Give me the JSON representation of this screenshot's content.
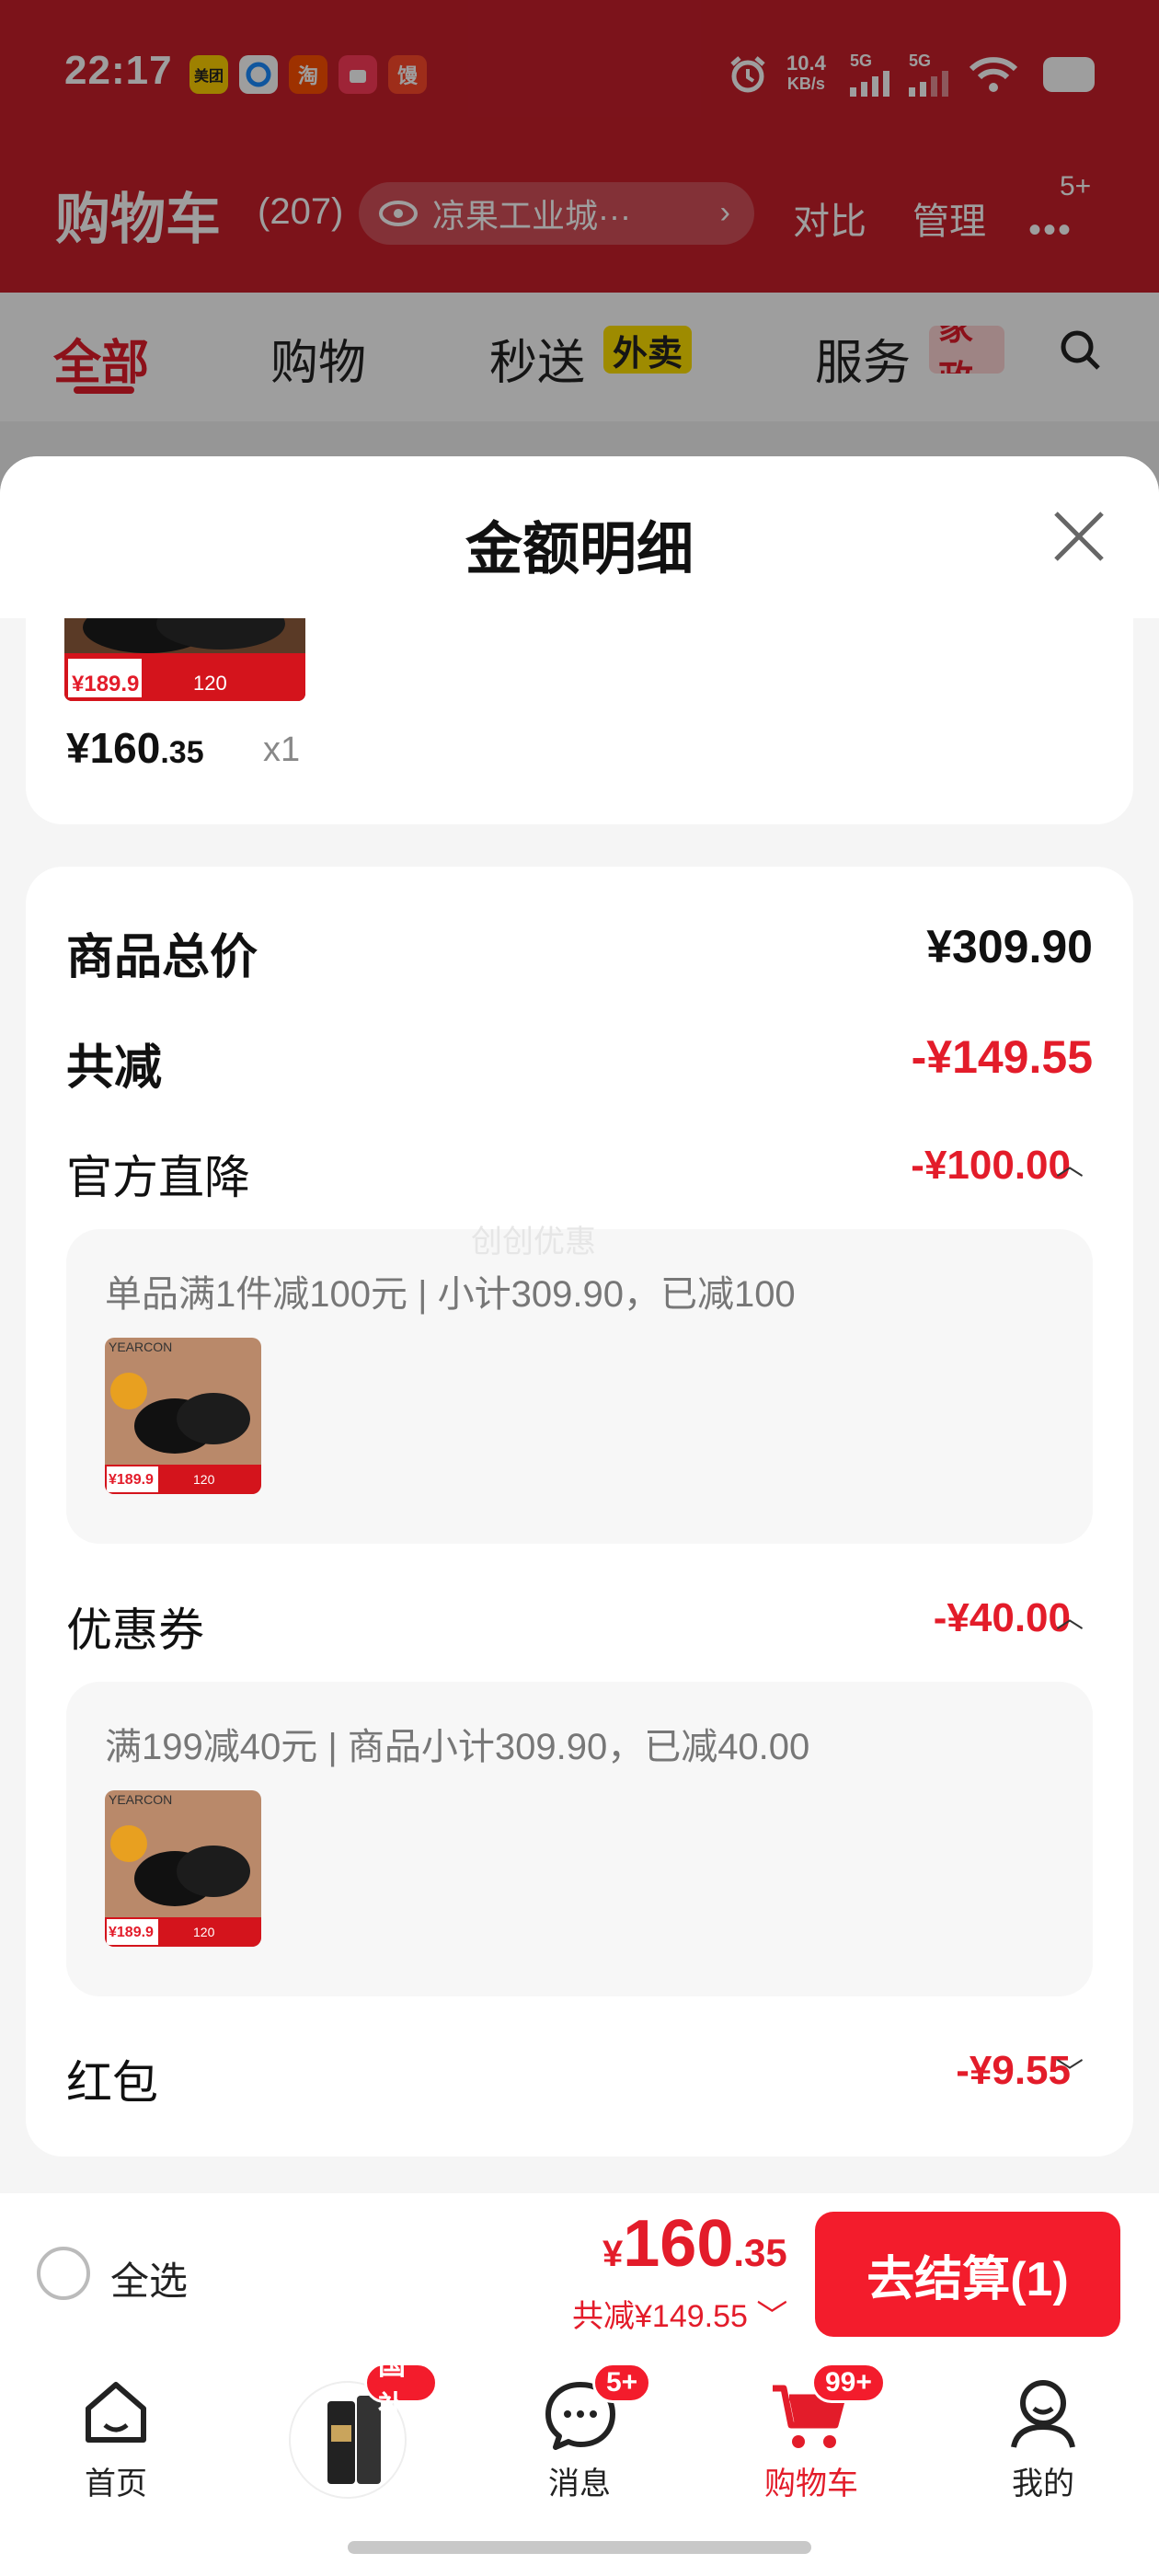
{
  "status_bar": {
    "time": "22:17",
    "apps": [
      "美团",
      "",
      "淘",
      "",
      "馒"
    ],
    "net_speed_value": "10.4",
    "net_speed_unit": "KB/s",
    "signal_1": "5G",
    "signal_2": "5G"
  },
  "header": {
    "title": "购物车",
    "count": "(207)",
    "location": "凉果工业城···",
    "compare": "对比",
    "manage": "管理",
    "more_badge": "5+"
  },
  "tabs": [
    {
      "label": "全部",
      "active": true
    },
    {
      "label": "购物"
    },
    {
      "label": "秒送",
      "tag": "外卖"
    },
    {
      "label": "服务",
      "tag": "家政"
    }
  ],
  "sheet": {
    "title": "金额明细",
    "top_item": {
      "price_int": "¥160",
      "price_dec": ".35",
      "qty": "x1",
      "thumb_price": "¥189.9",
      "thumb_badge": "120"
    },
    "goods_total_label": "商品总价",
    "goods_total_value": "¥309.90",
    "total_discount_label": "共减",
    "total_discount_value": "-¥149.55",
    "official_label": "官方直降",
    "official_value": "-¥100.00",
    "official_detail": "单品满1件减100元 | 小计309.90，已减100",
    "watermark": "创创优惠",
    "coupon_label": "优惠券",
    "coupon_value": "-¥40.00",
    "coupon_detail": "满199减40元 | 商品小计309.90，已减40.00",
    "redpacket_label": "红包",
    "redpacket_value": "-¥9.55",
    "thumb_brand": "YEARCON",
    "thumb_price": "¥189.9",
    "thumb_badge": "120"
  },
  "checkout": {
    "select_all": "全选",
    "price_symbol": "¥",
    "price_int": "160",
    "price_dec": ".35",
    "discount": "共减¥149.55",
    "button": "去结算(1)"
  },
  "nav": {
    "home": "首页",
    "promo_badge": "国补",
    "messages": "消息",
    "messages_badge": "5+",
    "cart": "购物车",
    "cart_badge": "99+",
    "mine": "我的"
  },
  "colors": {
    "brand_red": "#e31c2a",
    "header_red": "#c81f2b",
    "button_red": "#f31c2c"
  }
}
